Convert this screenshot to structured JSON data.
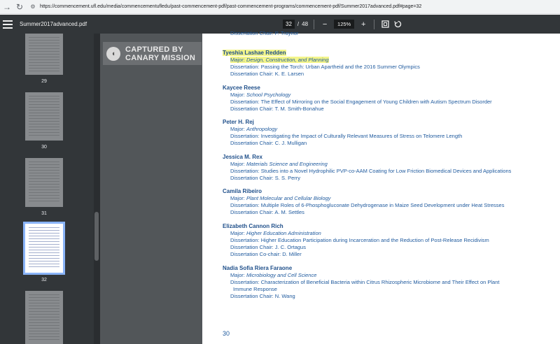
{
  "browser": {
    "url": "https://commencement.ufl.edu/media/commencementufledu/past-commencement-pdf/past-commencement-programs/commencement-pdf/Summer2017advanced.pdf#page=32"
  },
  "toolbar": {
    "file_name": "Summer2017advanced.pdf",
    "current_page": "32",
    "page_separator": "/",
    "total_pages": "48",
    "zoom": "125%",
    "zoom_out": "−",
    "zoom_in": "+"
  },
  "sidebar": {
    "thumbnails": [
      {
        "label": "29",
        "active": false
      },
      {
        "label": "30",
        "active": false
      },
      {
        "label": "31",
        "active": false
      },
      {
        "label": "32",
        "active": true
      },
      {
        "label": "",
        "active": false
      }
    ]
  },
  "watermark": {
    "line1": "CAPTURED BY",
    "line2": "CANARY MISSION"
  },
  "document": {
    "top_partial": "Dissertation Chair:  P. Traynor",
    "entries": [
      {
        "name": "Tyeshia Lashae Redden",
        "major": "Design, Construction, and Planning",
        "details": [
          "Dissertation:  Passing the Torch: Urban Apartheid and the 2016 Summer Olympics",
          "Dissertation Chair:  K. E. Larsen"
        ]
      },
      {
        "name": "Kaycee Reese",
        "major": "School Psychology",
        "details": [
          "Dissertation:  The Effect of Mirroring on the Social Engagement of Young Children with Autism Spectrum Disorder",
          "Dissertation Chair:  T. M. Smith-Bonahue"
        ]
      },
      {
        "name": "Peter H. Rej",
        "major": "Anthropology",
        "details": [
          "Dissertation:  Investigating the Impact of Culturally Relevant Measures of Stress on Telomere Length",
          "Dissertation Chair:  C. J. Mulligan"
        ]
      },
      {
        "name": "Jessica M. Rex",
        "major": "Materials Science and Engineering",
        "details": [
          "Dissertation:  Studies into a Novel Hydrophilic PVP-co-AAM Coating for Low Friction Biomedical Devices and Applications",
          "Dissertation Chair:  S. S. Perry"
        ]
      },
      {
        "name": "Camila Ribeiro",
        "major": "Plant Molecular and Cellular Biology",
        "details": [
          "Dissertation:  Multiple Roles of 6-Phosphogluconate Dehydrogenase in Maize Seed Development under Heat Stresses",
          "Dissertation Chair:  A. M. Settles"
        ]
      },
      {
        "name": "Elizabeth Cannon Rich",
        "major": "Higher Education Administration",
        "details": [
          "Dissertation:  Higher Education Participation during Incarceration and the Reduction of Post-Release Recidivism",
          "Dissertation Chair:  J. C. Ortagus",
          "Dissertation Co-chair:  D. Miller"
        ]
      },
      {
        "name": "Nadia Sofia Riera Faraone",
        "major": "Microbiology and Cell Science",
        "details": [
          "Dissertation:  Characterization of Beneficial Bacteria within Citrus Rhizospheric Microbiome and Their Effect on Plant",
          "Immune Response",
          "Dissertation Chair:  N. Wang"
        ]
      }
    ],
    "major_prefix": "Major:",
    "page_number": "30"
  }
}
